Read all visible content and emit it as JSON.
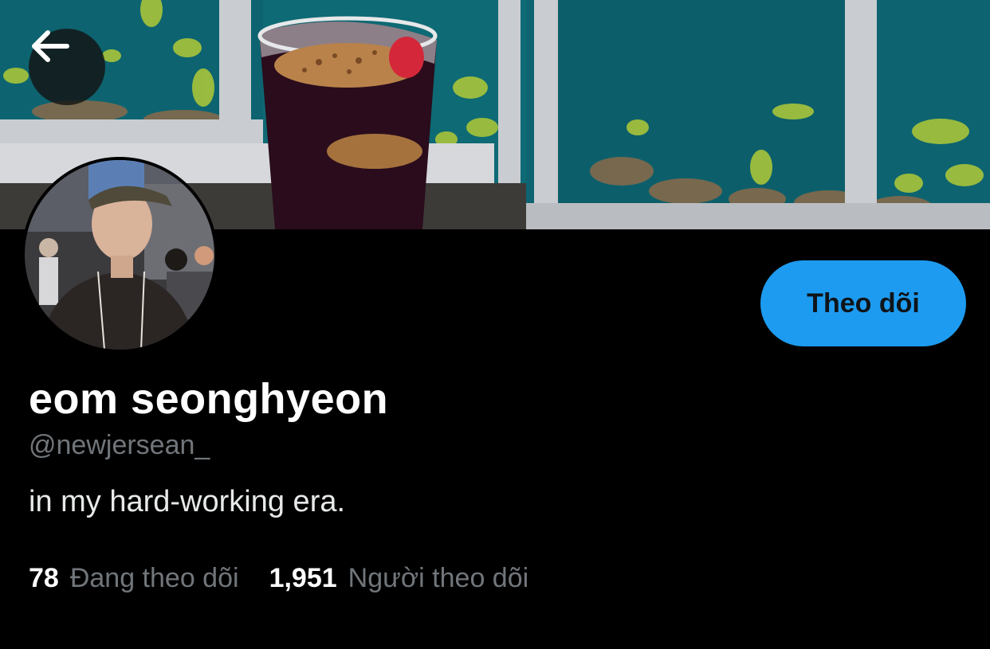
{
  "profile": {
    "display_name": "eom seonghyeon",
    "handle": "@newjersean_",
    "bio": "in my hard-working era."
  },
  "actions": {
    "follow_label": "Theo dõi",
    "back_icon": "arrow-left-icon"
  },
  "stats": {
    "following_count": "78",
    "following_label": "Đang theo dõi",
    "followers_count": "1,951",
    "followers_label": "Người theo dõi"
  },
  "colors": {
    "accent": "#1d9bf0",
    "background": "#000000",
    "secondary_text": "#71767b"
  }
}
